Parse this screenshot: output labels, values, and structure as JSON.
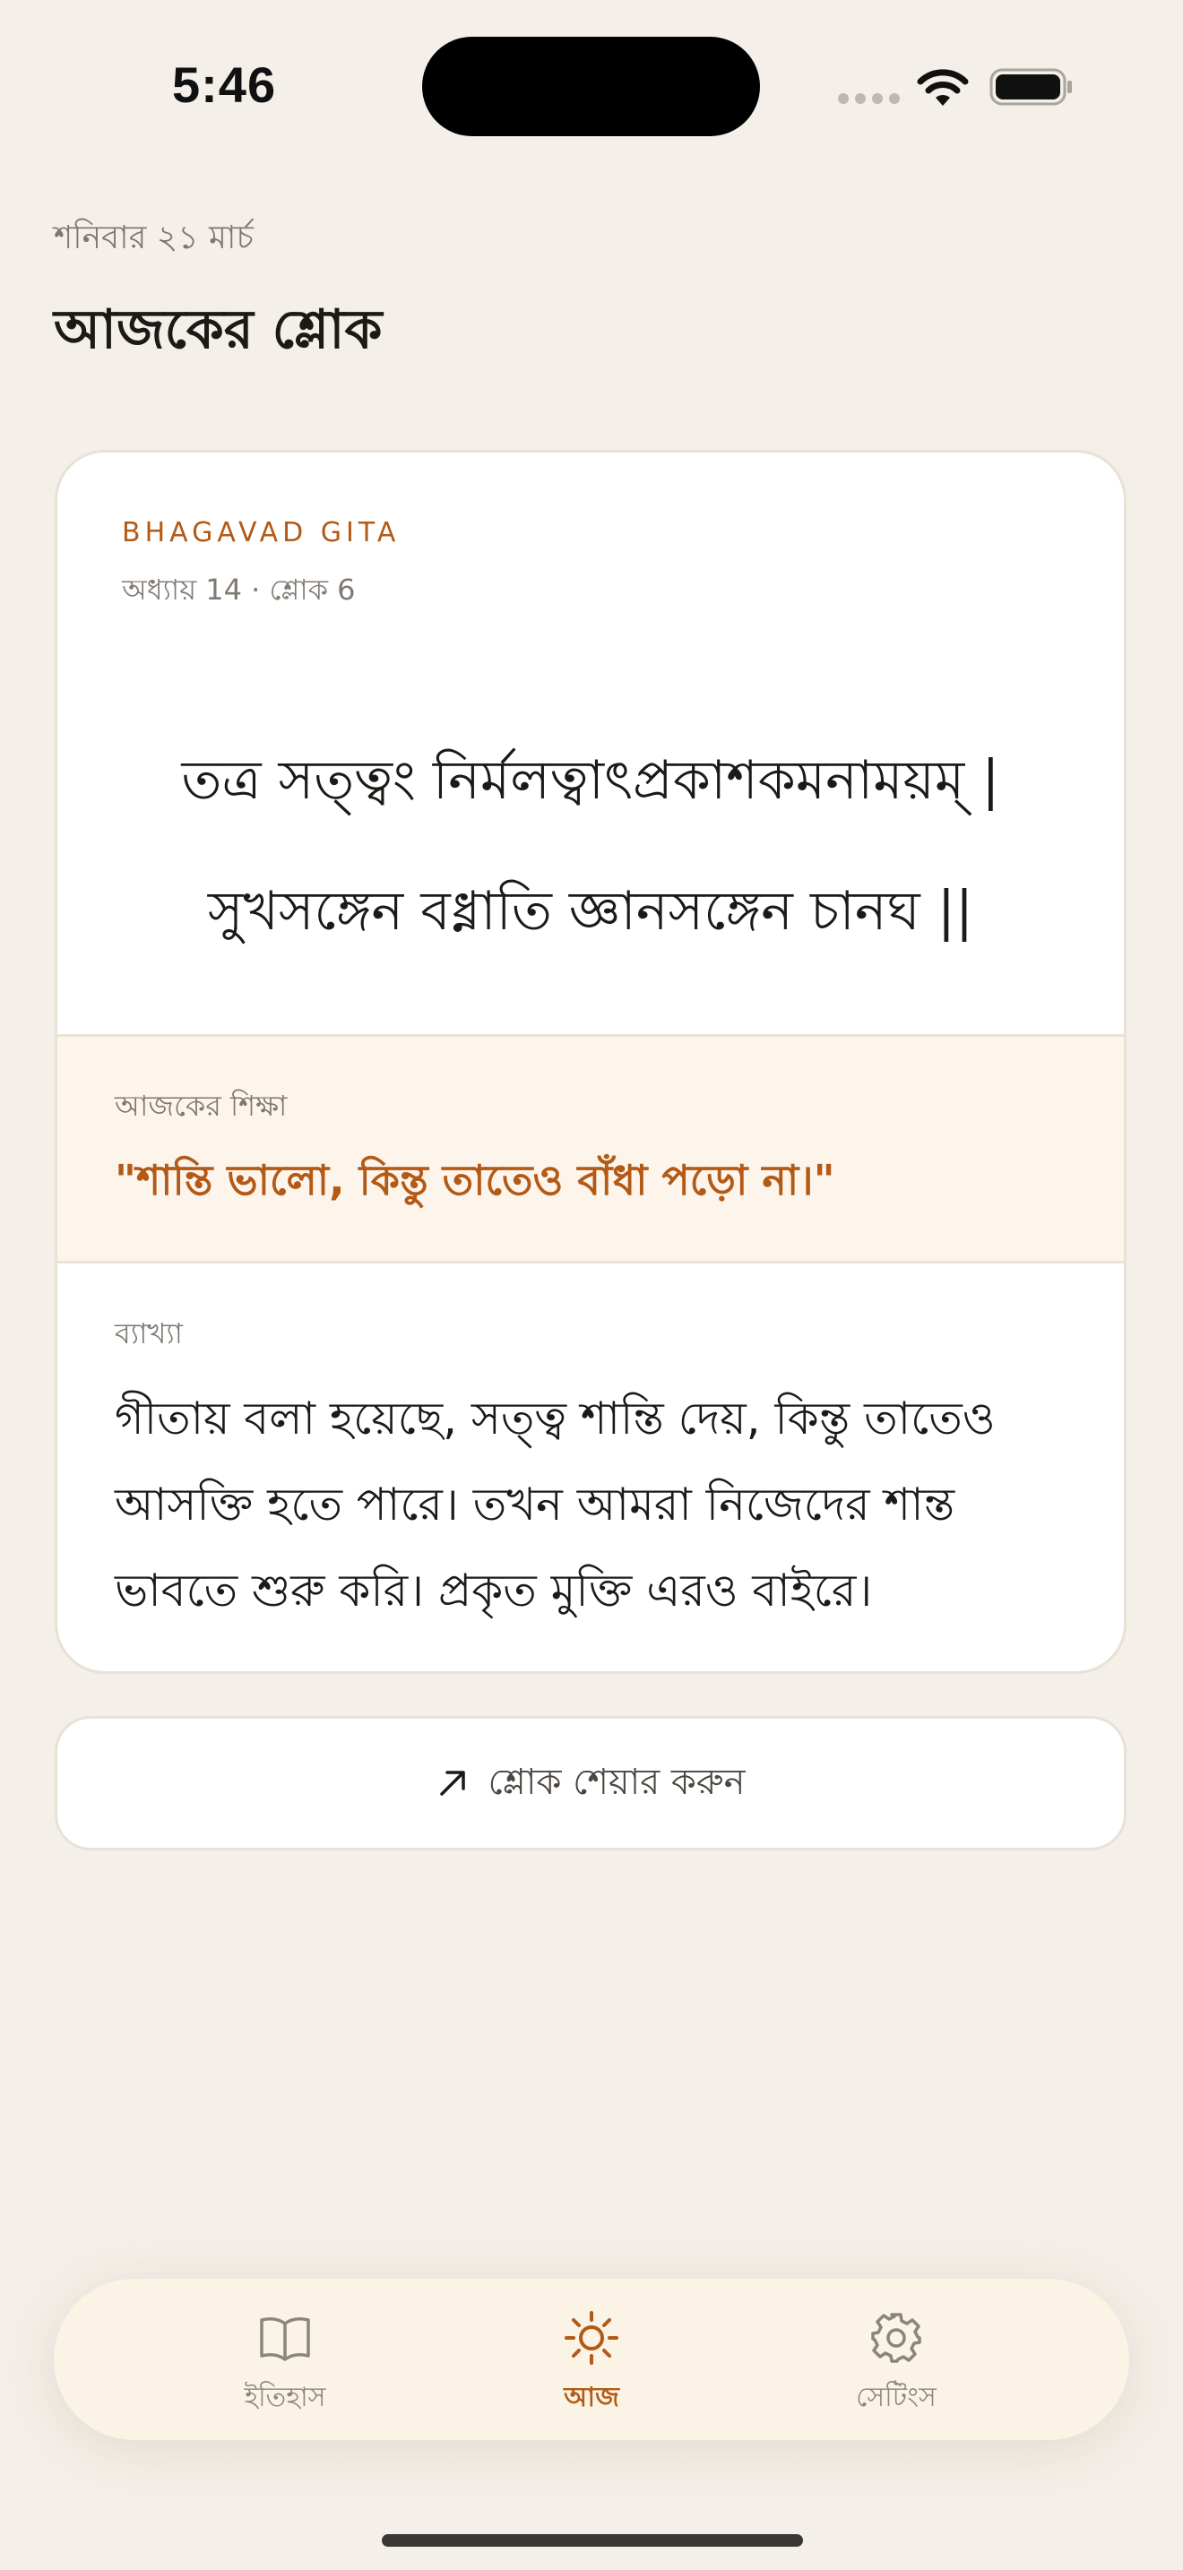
{
  "status_bar": {
    "time": "5:46"
  },
  "header": {
    "date": "শনিবার ২১ মার্চ",
    "title": "আজকের শ্লোক"
  },
  "card": {
    "source": "BHAGAVAD GITA",
    "chapter_ref": "অধ্যায় 14 · শ্লোক 6",
    "verse_lines": [
      "তত্র সত্ত্বং নির্মলত্বাৎপ্রকাশকমনাময়ম্ |",
      "সুখসঙ্গেন বধ্নাতি জ্ঞানসঙ্গেন চানঘ ||"
    ],
    "lesson_label": "আজকের শিক্ষা",
    "lesson_quote": "\"শান্তি ভালো, কিন্তু তাতেও বাঁধা পড়ো না।\"",
    "explanation_label": "ব্যাখ্যা",
    "explanation_text": "গীতায় বলা হয়েছে, সত্ত্ব শান্তি দেয়, কিন্তু তাতেও আসক্তি হতে পারে। তখন আমরা নিজেদের শান্ত ভাবতে শুরু করি। প্রকৃত মুক্তি এরও বাইরে।"
  },
  "share": {
    "label": "শ্লোক শেয়ার করুন",
    "icon": "arrow-up-right-icon"
  },
  "tabs": [
    {
      "label": "ইতিহাস",
      "icon": "book-icon",
      "active": false
    },
    {
      "label": "আজ",
      "icon": "sun-icon",
      "active": true
    },
    {
      "label": "সেটিংস",
      "icon": "gear-icon",
      "active": false
    }
  ],
  "colors": {
    "accent": "#b25a16",
    "background": "#f4f0e9",
    "lesson_bg": "#fdf5ec"
  }
}
